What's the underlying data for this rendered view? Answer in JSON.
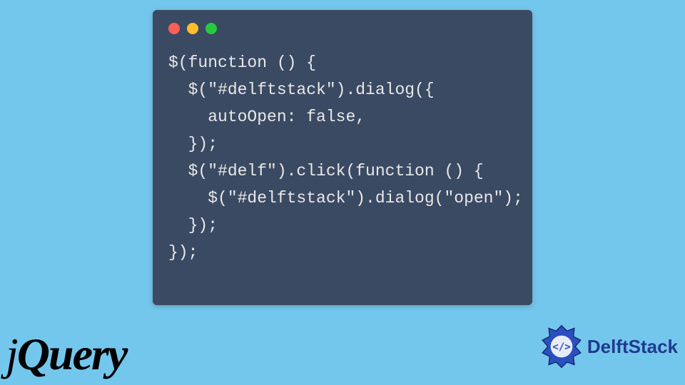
{
  "code": {
    "line1": "$(function () {",
    "line2": "  $(\"#delftstack\").dialog({",
    "line3": "    autoOpen: false,",
    "line4": "  });",
    "line5": "  $(\"#delf\").click(function () {",
    "line6": "    $(\"#delftstack\").dialog(\"open\");",
    "line7": "  });",
    "line8": "});"
  },
  "logos": {
    "jquery_j": "j",
    "jquery_rest": "Query",
    "delftstack": "DelftStack"
  },
  "window": {
    "dot_red": "close",
    "dot_yellow": "minimize",
    "dot_green": "zoom"
  }
}
